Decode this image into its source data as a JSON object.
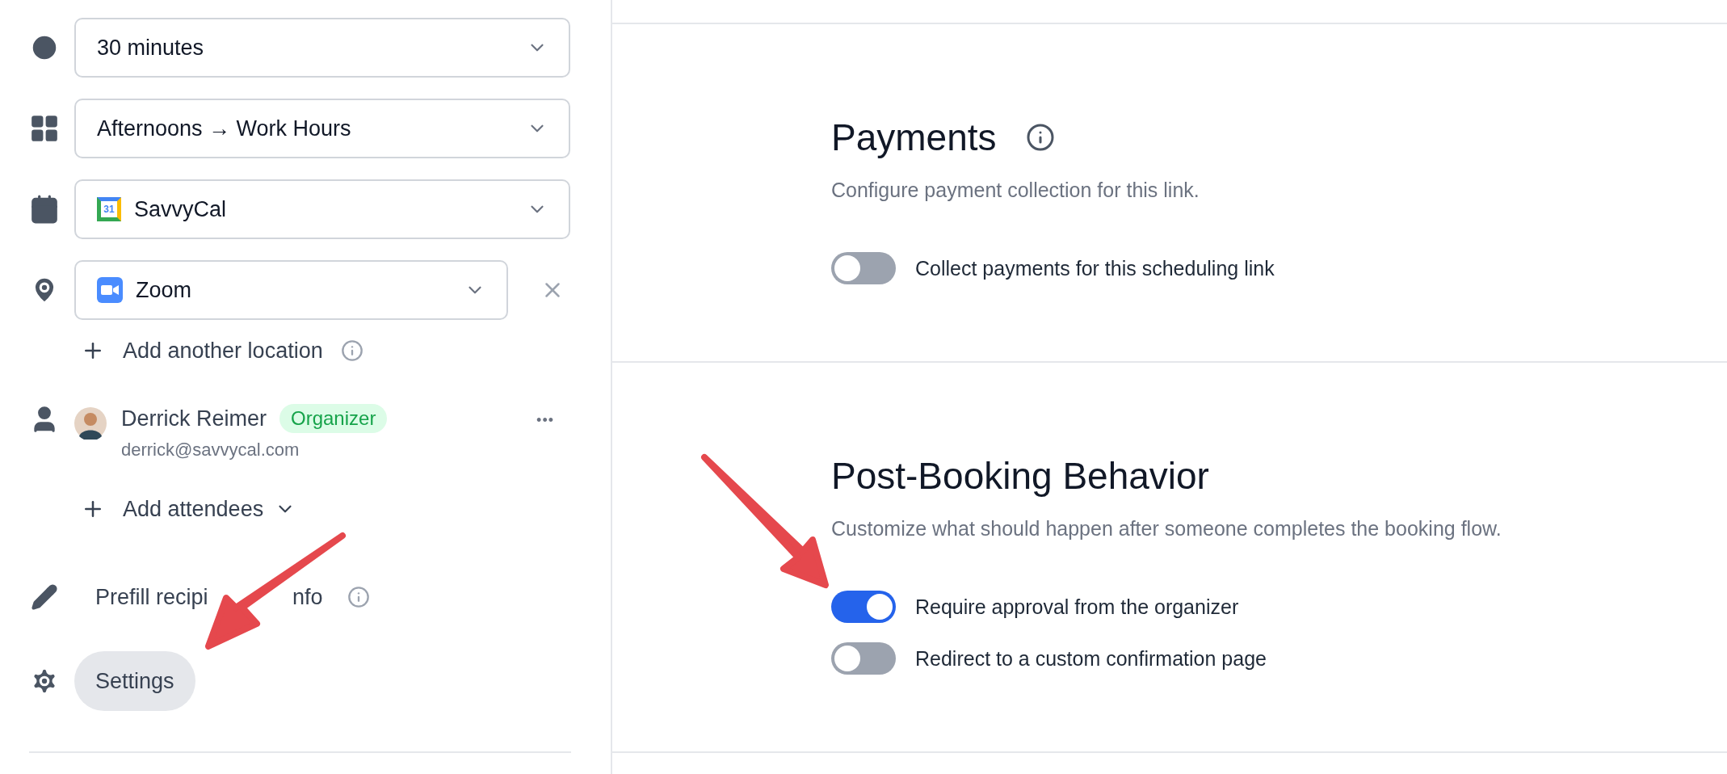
{
  "sidebar": {
    "fields": [
      {
        "kind": "duration",
        "value": "30 minutes",
        "removable": false
      },
      {
        "kind": "availability",
        "value": "Afternoons → Work Hours",
        "removable": false
      },
      {
        "kind": "calendar",
        "value": "SavvyCal",
        "logo_text": "31",
        "removable": false
      },
      {
        "kind": "location",
        "value": "Zoom",
        "removable": true
      }
    ],
    "add_location": {
      "label": "Add another location"
    },
    "attendee": {
      "name": "Derrick Reimer",
      "badge": "Organizer",
      "email": "derrick@savvycal.com",
      "more": "•••"
    },
    "add_attendees": {
      "label": "Add attendees"
    },
    "prefill": {
      "label_parts": [
        "Prefill recipi",
        "nfo"
      ]
    },
    "settings": {
      "label": "Settings",
      "selected": true
    }
  },
  "main": {
    "sections": [
      {
        "kind": "titled_with_info",
        "title": "Payments",
        "description": "Configure payment collection for this link.",
        "toggles": [
          {
            "label": "Collect payments for this scheduling link",
            "on": false
          }
        ]
      },
      {
        "kind": "titled",
        "title": "Post-Booking Behavior",
        "description": "Customize what should happen after someone completes the booking flow.",
        "toggles": [
          {
            "label": "Require approval from the organizer",
            "on": true
          },
          {
            "label": "Redirect to a custom confirmation page",
            "on": false
          }
        ]
      }
    ]
  }
}
